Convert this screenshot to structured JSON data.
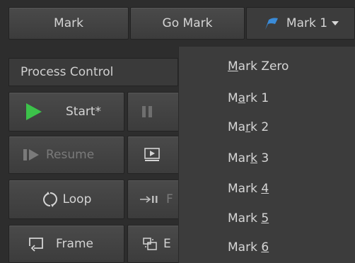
{
  "toolbar": {
    "mark_label": "Mark",
    "go_mark_label": "Go Mark",
    "mark_selector_label": "Mark 1",
    "mark_flag_color": "#3a8bd8"
  },
  "panel": {
    "title": "Process Control",
    "start_label": "Start*",
    "resume_label": "Resume",
    "loop_label": "Loop",
    "frame_label": "Frame",
    "partial_right_labels": [
      "F",
      "E"
    ]
  },
  "mark_menu": {
    "items": [
      {
        "pre": "",
        "u": "M",
        "post": "ark Zero"
      },
      {
        "pre": "M",
        "u": "a",
        "post": "rk 1"
      },
      {
        "pre": "Ma",
        "u": "r",
        "post": "k 2"
      },
      {
        "pre": "Mar",
        "u": "k",
        "post": " 3"
      },
      {
        "pre": "Mark ",
        "u": "4",
        "post": ""
      },
      {
        "pre": "Mark ",
        "u": "5",
        "post": ""
      },
      {
        "pre": "Mark ",
        "u": "6",
        "post": ""
      }
    ]
  },
  "colors": {
    "play_green": "#3cc24a",
    "background": "#2d2d2d",
    "menu_background": "#3c3c3c"
  }
}
